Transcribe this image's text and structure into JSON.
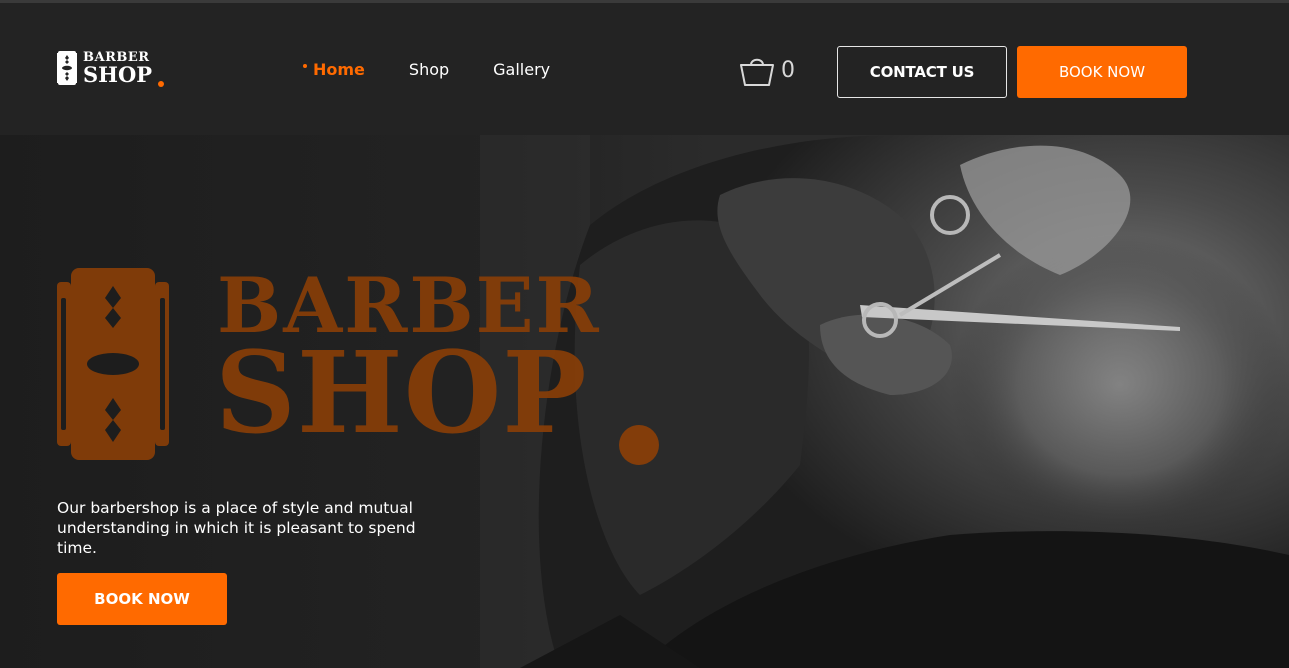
{
  "header": {
    "logo": {
      "line1": "BARBER",
      "line2": "SHOP"
    },
    "nav": [
      {
        "label": "Home",
        "active": true
      },
      {
        "label": "Shop",
        "active": false
      },
      {
        "label": "Gallery",
        "active": false
      }
    ],
    "cart": {
      "icon": "shopping-bag-icon",
      "count": "0"
    },
    "contact_label": "CONTACT US",
    "book_label": "BOOK NOW"
  },
  "hero": {
    "brand": {
      "line1": "BARBER",
      "line2": "SHOP"
    },
    "description": "Our barbershop is a place of style and mutual understanding in which it is pleasant to spend time.",
    "book_label": "BOOK NOW"
  },
  "colors": {
    "accent": "#ff6a00",
    "header_bg": "#232323",
    "hero_brand": "#883e08"
  }
}
